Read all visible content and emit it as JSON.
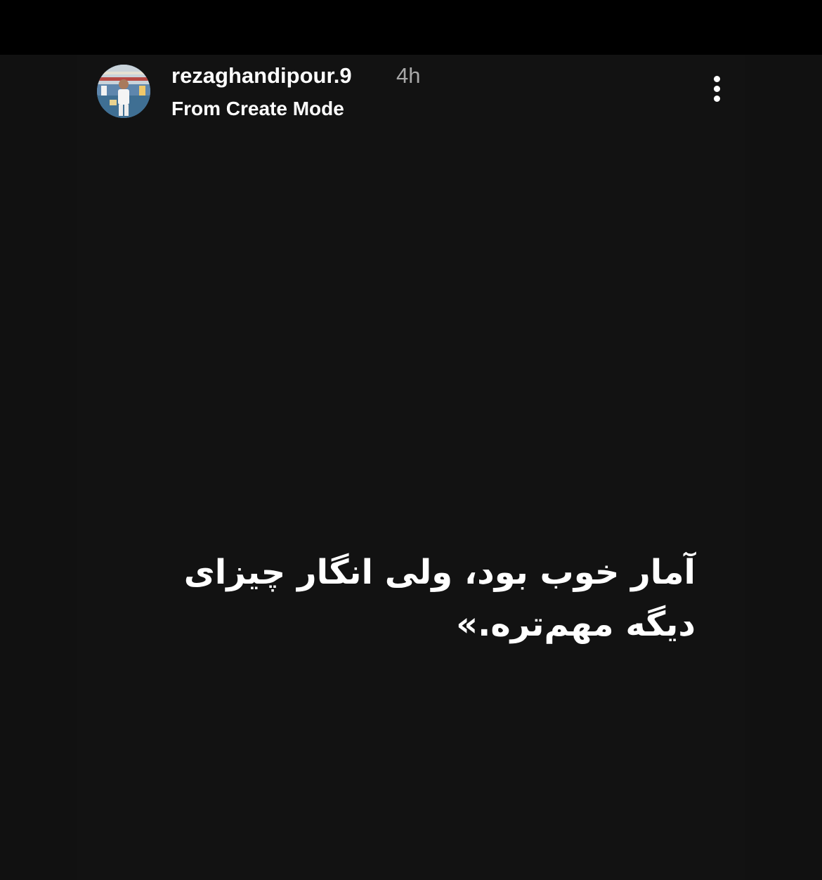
{
  "story": {
    "username": "rezaghandipour.9",
    "time_ago": "4h",
    "subtitle": "From Create Mode",
    "caption_lines": [
      "آمار خوب بود، ولی انگار چیزای",
      "دیگه مهم‌تره.»"
    ]
  },
  "icons": {
    "avatar": "profile-photo",
    "more": "vertical-ellipsis-icon"
  },
  "colors": {
    "background": "#121212",
    "text": "#ffffff",
    "muted": "#a8a8a8"
  }
}
